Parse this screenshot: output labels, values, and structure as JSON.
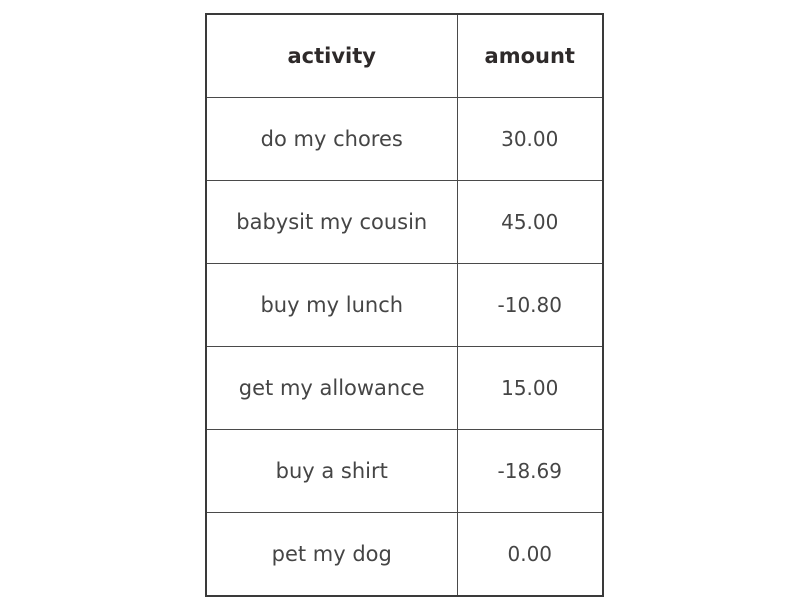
{
  "table": {
    "headers": {
      "activity": "activity",
      "amount": "amount"
    },
    "rows": [
      {
        "activity": "do my chores",
        "amount": "30.00"
      },
      {
        "activity": "babysit my cousin",
        "amount": "45.00"
      },
      {
        "activity": "buy my lunch",
        "amount": "-10.80"
      },
      {
        "activity": "get my allowance",
        "amount": "15.00"
      },
      {
        "activity": "buy a shirt",
        "amount": "-18.69"
      },
      {
        "activity": "pet my dog",
        "amount": "0.00"
      }
    ]
  }
}
